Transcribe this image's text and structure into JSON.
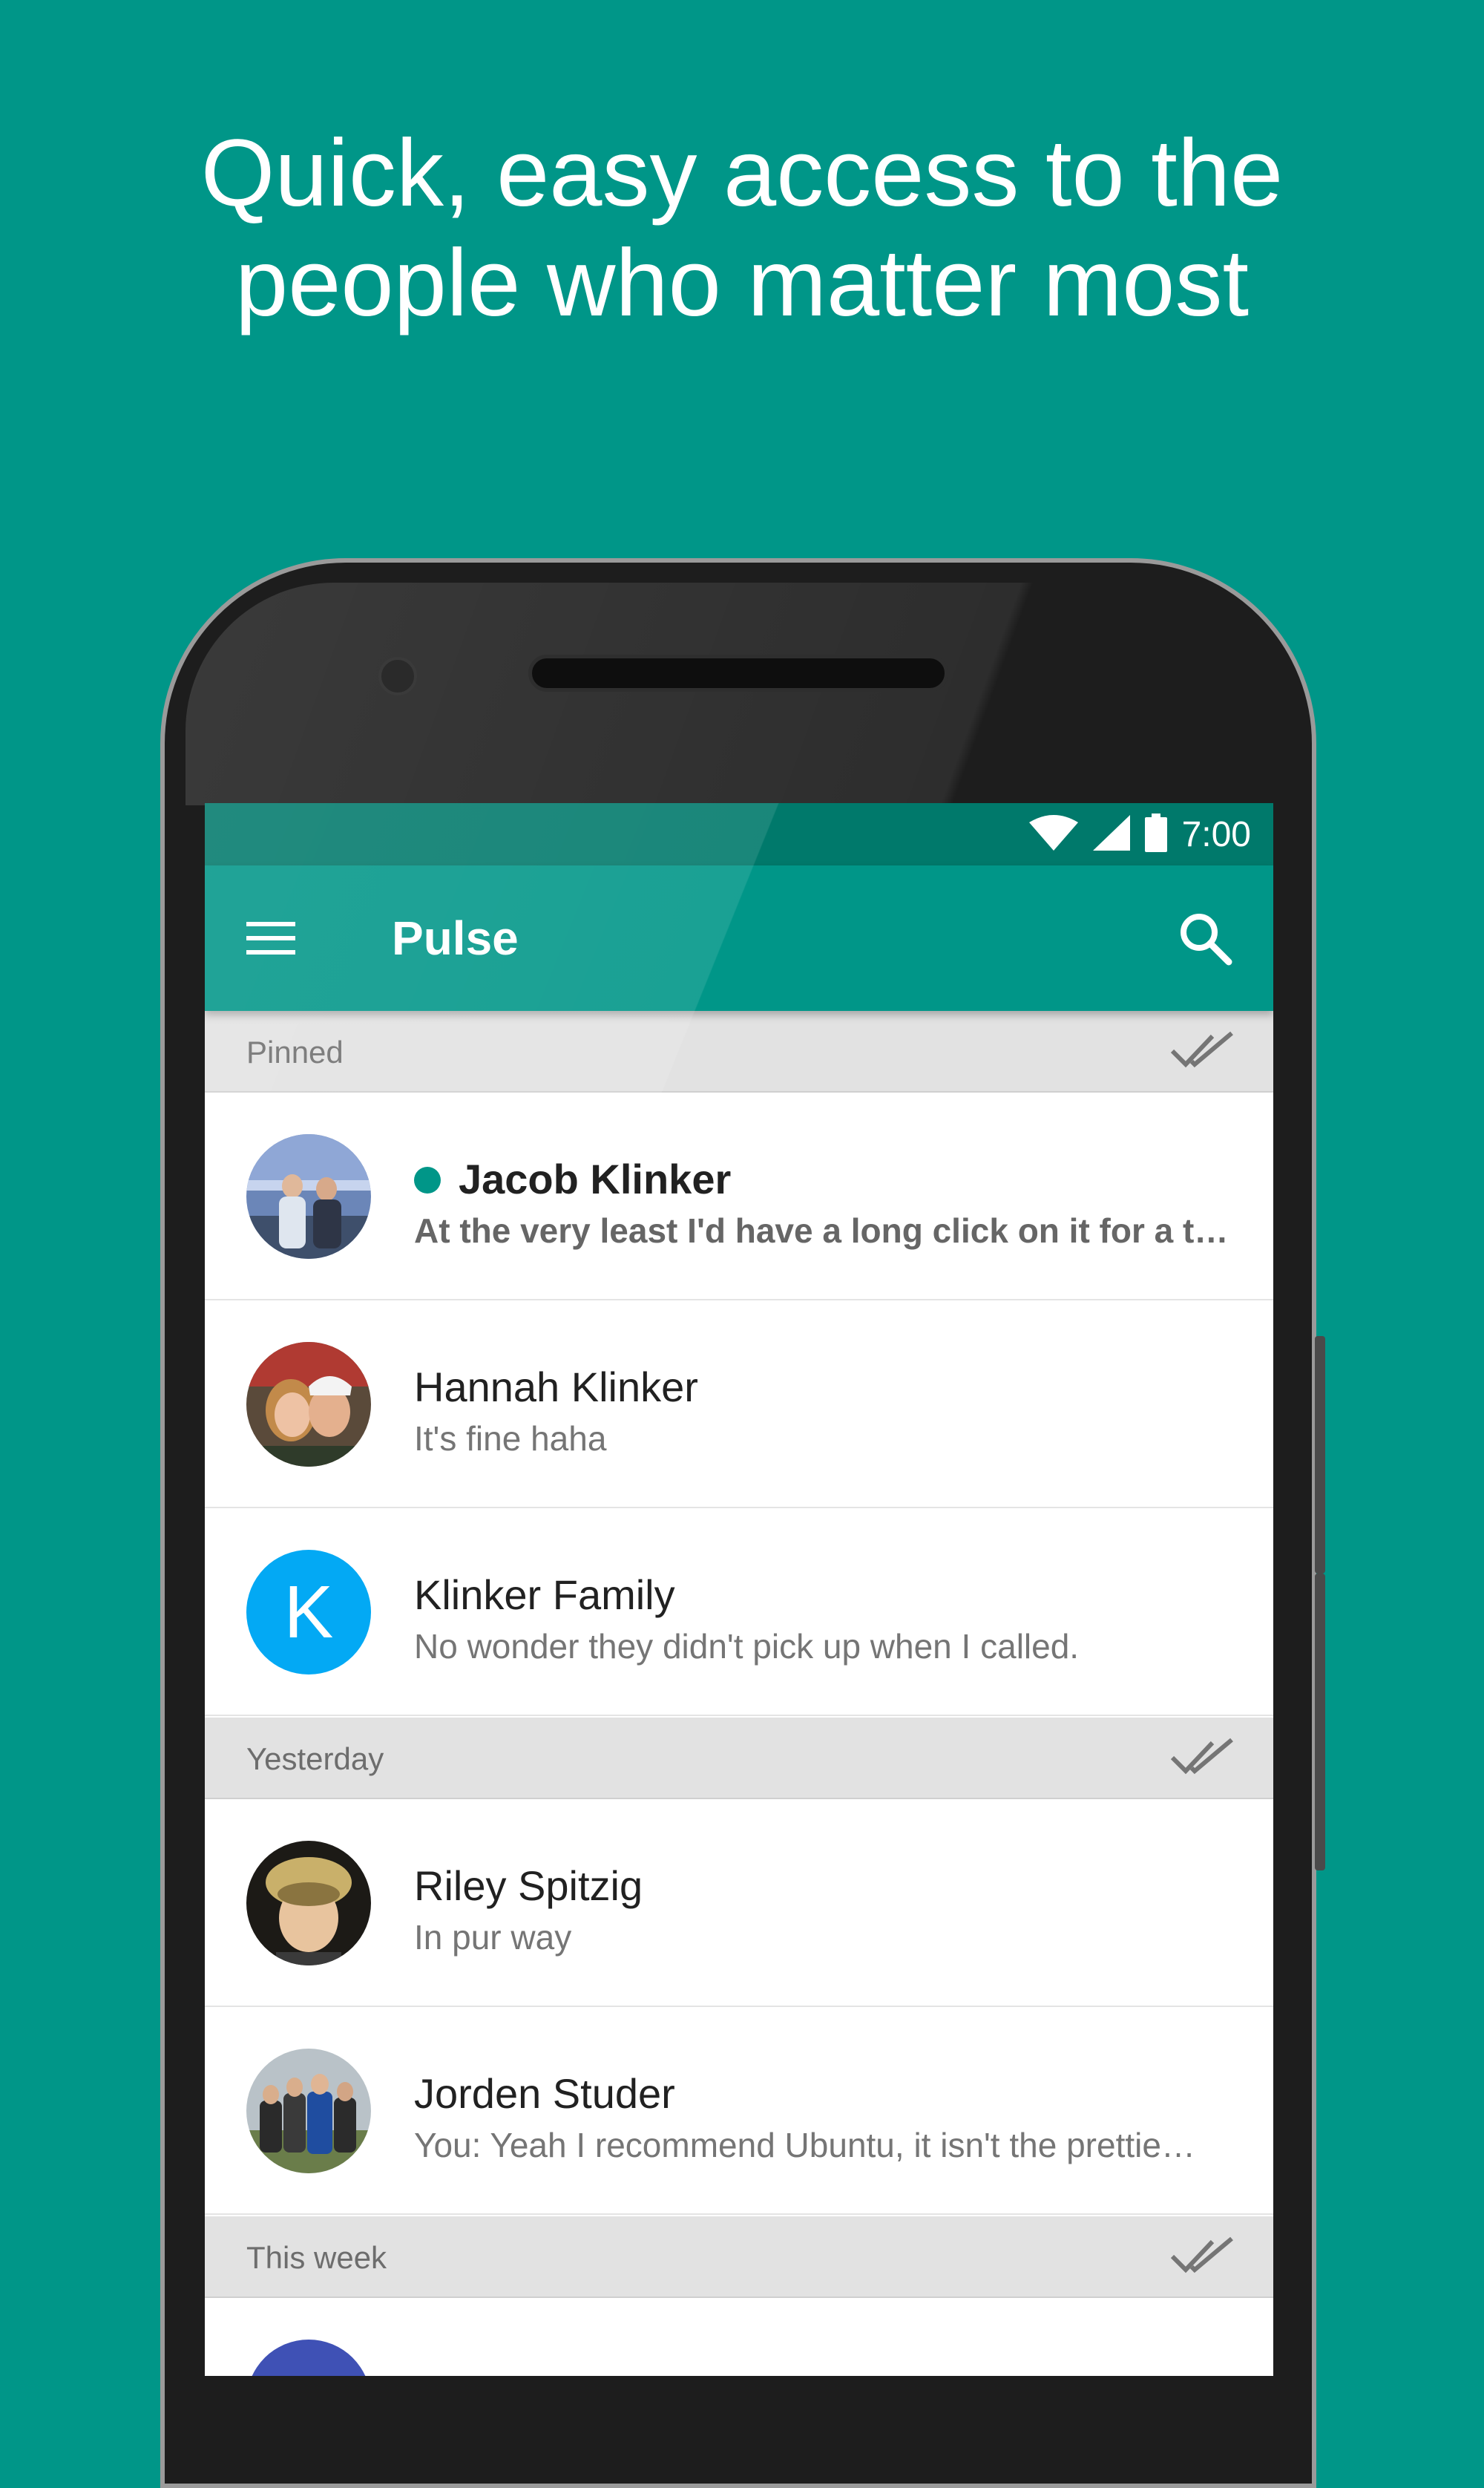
{
  "headline": {
    "line1": "Quick, easy access to the",
    "line2": "people who matter most"
  },
  "colors": {
    "background": "#009688",
    "primary": "#009688",
    "primary_dark": "#00796b",
    "accent": "#ff9800",
    "unread_dot": "#009688",
    "letter_avatar": "#03a9f4"
  },
  "status_bar": {
    "time": "7:00",
    "icons": [
      "wifi-icon",
      "signal-icon",
      "battery-icon"
    ]
  },
  "app_bar": {
    "title": "Pulse",
    "menu_icon": "hamburger-menu-icon",
    "search_icon": "search-icon"
  },
  "sections": [
    {
      "title": "Pinned",
      "action_icon": "double-check-icon",
      "conversations": [
        {
          "name": "Jacob Klinker",
          "message": "At the very least I'd have a long click on it for a t…",
          "unread": true,
          "avatar": "photo"
        },
        {
          "name": "Hannah Klinker",
          "message": "It's fine haha",
          "unread": false,
          "avatar": "photo"
        },
        {
          "name": "Klinker Family",
          "message": "No wonder they didn't pick up when I called.",
          "unread": false,
          "avatar_letter": "K"
        }
      ]
    },
    {
      "title": "Yesterday",
      "action_icon": "double-check-icon",
      "conversations": [
        {
          "name": "Riley Spitzig",
          "message": "In pur way",
          "unread": false,
          "avatar": "photo"
        },
        {
          "name": "Jorden Studer",
          "message": "You: Yeah I recommend Ubuntu, it isn't the prettie…",
          "unread": false,
          "avatar": "photo"
        }
      ]
    },
    {
      "title": "This week",
      "action_icon": "double-check-icon",
      "conversations": []
    }
  ]
}
